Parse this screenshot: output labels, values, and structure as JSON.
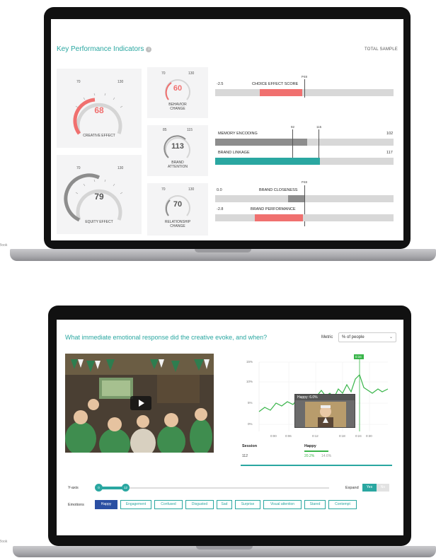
{
  "laptop_model": "MacBook Pro",
  "kpi": {
    "title": "Key Performance Indicators",
    "info_icon": "info-icon",
    "total_sample": "TOTAL SAMPLE",
    "gauges": {
      "creative": {
        "min": "70",
        "max": "130",
        "value": "68",
        "label": "CREATIVE EFFECT",
        "color": "#f0706f"
      },
      "equity": {
        "min": "70",
        "max": "130",
        "value": "79",
        "label": "EQUITY EFFECT",
        "color": "#8d8d8d"
      },
      "behavior": {
        "min": "70",
        "max": "130",
        "value": "60",
        "label": "BEHAVIOR CHANGE",
        "color": "#f0706f"
      },
      "brand_attention": {
        "min": "85",
        "max": "115",
        "value": "113",
        "label": "BRAND ATTENTION",
        "color": "#8d8d8d"
      },
      "relationship": {
        "min": "70",
        "max": "130",
        "value": "70",
        "label": "RELATIONSHIP CHANGE",
        "color": "#8d8d8d"
      }
    },
    "bars": {
      "choice": {
        "num": "-2.5",
        "label": "CHOICE EFFECT SCORE",
        "marker": "P48"
      },
      "memory": {
        "label": "MEMORY ENCODING",
        "value": "102",
        "m1": "92",
        "m2": "115"
      },
      "linkage": {
        "label": "BRAND LINKAGE",
        "value": "117"
      },
      "closeness": {
        "num": "0.0",
        "label": "BRAND CLOSENESS",
        "marker": "P48"
      },
      "performance": {
        "num": "-2.8",
        "label": "BRAND PERFORMANCE"
      }
    }
  },
  "emotion": {
    "question": "What immediate emotional response did the creative evoke, and when?",
    "metric_label": "Metric",
    "metric_value": "% of people",
    "chart": {
      "y_ticks": [
        "15%",
        "10%",
        "5%",
        "0%"
      ],
      "x_ticks": [
        "0:00",
        "0:06",
        "0:12",
        "0:18",
        "0:24",
        "0:30"
      ],
      "badge": "0:34",
      "tooltip": "Happy: 6.0%"
    },
    "session_header": "Session",
    "happy_header": "Happy",
    "session_value": "112",
    "happy_value": "20.2%",
    "happy_sub": "14.6%",
    "xaxis_label": "Y-axis",
    "knob_start": "0",
    "knob_end": "12",
    "expand_label": "Expand",
    "expand_yes": "Yes",
    "expand_no": "No",
    "emotions_label": "Emotions",
    "chips": [
      "Happy",
      "Engagement",
      "Confused",
      "Disgusted",
      "Sad",
      "Surprise",
      "Visual attention",
      "Stared",
      "Contempt"
    ]
  },
  "colors": {
    "teal": "#2aa7a1",
    "red": "#f0706f",
    "blue": "#2b4fa3",
    "green": "#39b54a"
  }
}
